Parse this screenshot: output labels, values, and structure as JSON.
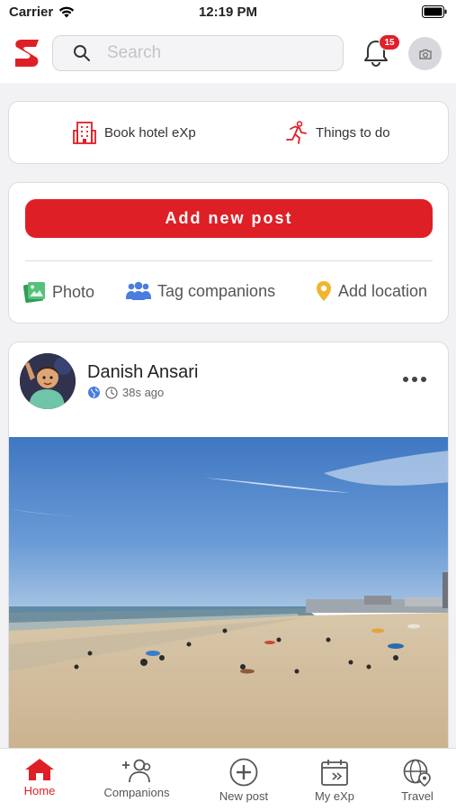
{
  "status_bar": {
    "carrier": "Carrier",
    "time": "12:19 PM"
  },
  "header": {
    "search_placeholder": "Search",
    "notification_count": "15"
  },
  "quick_links": {
    "hotel": "Book hotel eXp",
    "things": "Things to do"
  },
  "composer": {
    "add_post": "Add new post",
    "photo": "Photo",
    "tag": "Tag companions",
    "location": "Add location"
  },
  "post": {
    "author": "Danish Ansari",
    "time_ago": "38s ago"
  },
  "tabs": {
    "home": "Home",
    "companions": "Companions",
    "new_post": "New post",
    "my_exp": "My eXp",
    "travel": "Travel"
  },
  "colors": {
    "brand": "#df1f26",
    "photo_icon": "#3dae63",
    "tag_icon": "#4a7de0",
    "location_icon": "#f0b530"
  }
}
